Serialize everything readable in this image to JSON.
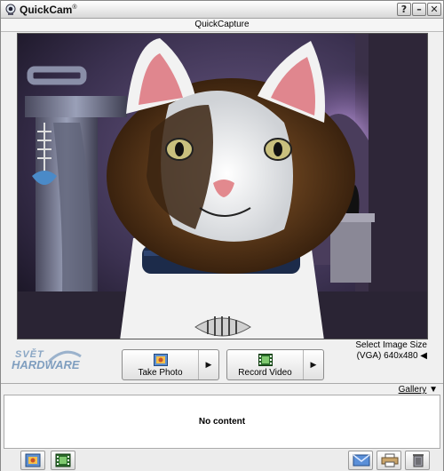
{
  "window": {
    "title": "QuickCam",
    "title_mark": "®",
    "controls": {
      "help": "?",
      "minimize": "–",
      "close": "✕"
    }
  },
  "capture": {
    "title": "QuickCapture"
  },
  "logo": {
    "line1": "SVĚT",
    "line2": "HARDWARE",
    "line3": ""
  },
  "controls": {
    "take_photo": {
      "label": "Take Photo",
      "icon": "photo-icon"
    },
    "record_video": {
      "label": "Record Video",
      "icon": "film-icon"
    },
    "image_size": {
      "label": "Select Image Size",
      "value": "(VGA) 640x480"
    }
  },
  "gallery": {
    "label": "Gallery",
    "empty_text": "No content"
  },
  "toolbar": {
    "left": [
      "photo-filter-icon",
      "video-filter-icon"
    ],
    "right": [
      "email-icon",
      "print-icon",
      "trash-icon"
    ]
  },
  "colors": {
    "accent": "#7f9ebf",
    "preview_bg": "#1a1626"
  }
}
